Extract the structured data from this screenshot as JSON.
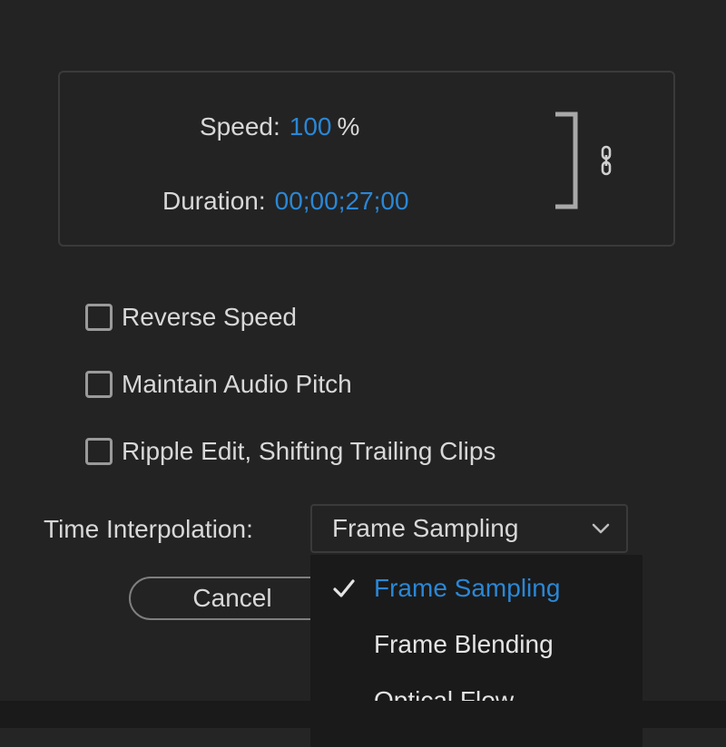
{
  "colors": {
    "accent": "#2a87d6"
  },
  "speed": {
    "label": "Speed:",
    "value": "100",
    "unit": "%"
  },
  "duration": {
    "label": "Duration:",
    "value": "00;00;27;00"
  },
  "checkboxes": {
    "reverse_label": "Reverse Speed",
    "pitch_label": "Maintain Audio Pitch",
    "ripple_label": "Ripple Edit, Shifting Trailing Clips"
  },
  "time_interpolation": {
    "label": "Time Interpolation:",
    "selected": "Frame Sampling",
    "options": [
      "Frame Sampling",
      "Frame Blending",
      "Optical Flow"
    ]
  },
  "buttons": {
    "cancel": "Cancel"
  }
}
